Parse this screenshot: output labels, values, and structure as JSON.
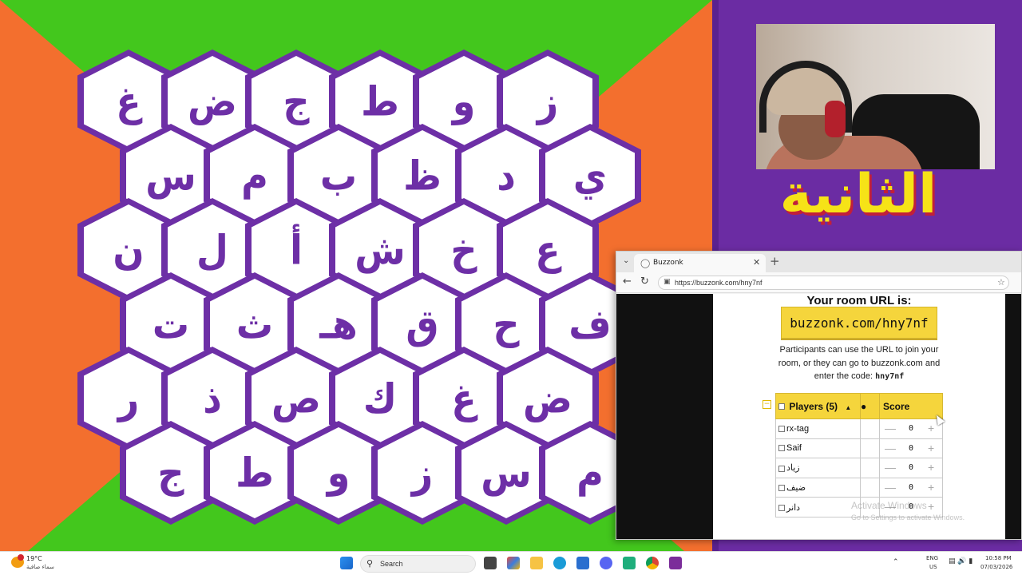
{
  "board": {
    "rows": [
      [
        "غ",
        "ض",
        "ج",
        "ط",
        "و",
        "ز"
      ],
      [
        "س",
        "م",
        "ب",
        "ظ",
        "د",
        "ي"
      ],
      [
        "ن",
        "ل",
        "أ",
        "ش",
        "خ",
        "ع"
      ],
      [
        "ت",
        "ث",
        "هـ",
        "ق",
        "ح",
        "ف"
      ],
      [
        "ر",
        "ذ",
        "ص",
        "ك",
        "غ",
        "ض"
      ],
      [
        "ج",
        "ط",
        "و",
        "ز",
        "س",
        "م"
      ]
    ],
    "colors": {
      "green": "#43c71d",
      "orange": "#f36f2e",
      "purple": "#6d2fa6",
      "tile": "#ffffff"
    }
  },
  "stream": {
    "title": "الثانية",
    "title_color": "#f6e317",
    "background_color": "#6b2ca3"
  },
  "browser": {
    "tab_title": "Buzzonk",
    "url": "https://buzzonk.com/hny7nf",
    "page": {
      "heading": "Your room URL is:",
      "room_url": "buzzonk.com/hny7nf",
      "instructions": "Participants can use the URL to join your room, or they can go to buzzonk.com and enter the code:",
      "room_code": "hny7nf",
      "table": {
        "players_header": "Players (5)",
        "score_header": "Score",
        "rows": [
          {
            "name": "rx-tag",
            "score": "0"
          },
          {
            "name": "Saif",
            "score": "0"
          },
          {
            "name": "زياد",
            "score": "0"
          },
          {
            "name": "ضيف",
            "score": "0"
          },
          {
            "name": "دانر",
            "score": "0"
          }
        ]
      },
      "accent_color": "#f5d53c"
    }
  },
  "watermark": {
    "title": "Activate Windows",
    "subtitle": "Go to Settings to activate Windows."
  },
  "taskbar": {
    "weather_temp": "19°C",
    "weather_desc": "سماء صافية",
    "search_label": "Search",
    "lang_top": "ENG",
    "lang_bottom": "US",
    "time": "10:58 PM",
    "date": "07/03/2026"
  }
}
